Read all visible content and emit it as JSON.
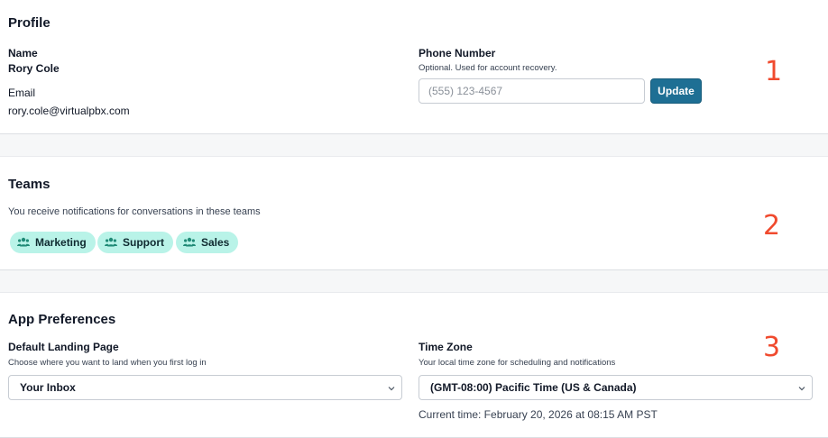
{
  "profile": {
    "title": "Profile",
    "name_label": "Name",
    "name_value": "Rory Cole",
    "email_label": "Email",
    "email_value": "rory.cole@virtualpbx.com",
    "phone_label": "Phone Number",
    "phone_help": "Optional. Used for account recovery.",
    "phone_placeholder": "(555) 123-4567",
    "phone_value": "",
    "update_label": "Update",
    "callout": "1"
  },
  "teams": {
    "title": "Teams",
    "description": "You receive notifications for conversations in these teams",
    "items": [
      {
        "label": "Marketing",
        "icon": "users-icon"
      },
      {
        "label": "Support",
        "icon": "users-icon"
      },
      {
        "label": "Sales",
        "icon": "users-icon"
      }
    ],
    "callout": "2"
  },
  "preferences": {
    "title": "App Preferences",
    "landing_label": "Default Landing Page",
    "landing_help": "Choose where you want to land when you first log in",
    "landing_value": "Your Inbox",
    "timezone_label": "Time Zone",
    "timezone_help": "Your local time zone for scheduling and notifications",
    "timezone_value": "(GMT-08:00) Pacific Time (US & Canada)",
    "current_time": "Current time: February 20, 2026 at 08:15 AM PST",
    "callout": "3"
  },
  "colors": {
    "accent": "#1e6f94",
    "chip_bg": "#b9f3e8",
    "callout": "#f04a2e"
  }
}
